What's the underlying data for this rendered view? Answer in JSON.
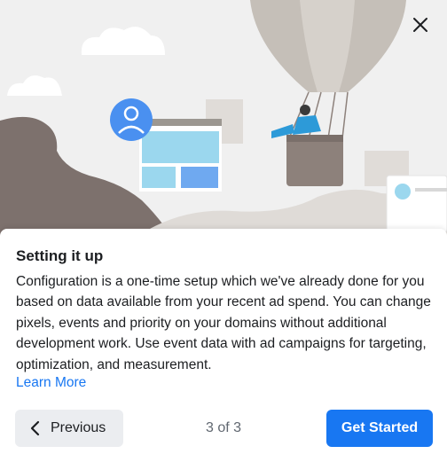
{
  "dialog": {
    "title": "Setting it up",
    "body": "Configuration is a one-time setup which we've already done for you based on data available from your recent ad spend. You can change pixels, events and priority on your domains without additional development work. Use event data with ad campaigns for targeting, optimization, and measurement.",
    "learn_more": "Learn More",
    "pager": "3 of 3",
    "previous_label": "Previous",
    "primary_label": "Get Started"
  },
  "icons": {
    "close": "close-icon",
    "previous": "chevron-left-icon",
    "avatar": "person-avatar-icon"
  },
  "colors": {
    "primary": "#1877f2",
    "secondary_button": "#ebedf0",
    "text": "#1c1e21",
    "muted": "#606770",
    "link": "#1877f2",
    "illustration_bg": "#f0f0f0",
    "balloon": "#c5bfb8",
    "balloon_dark": "#8d817b",
    "screen_blue": "#9bd7ee",
    "avatar_blue": "#4a90f0"
  }
}
